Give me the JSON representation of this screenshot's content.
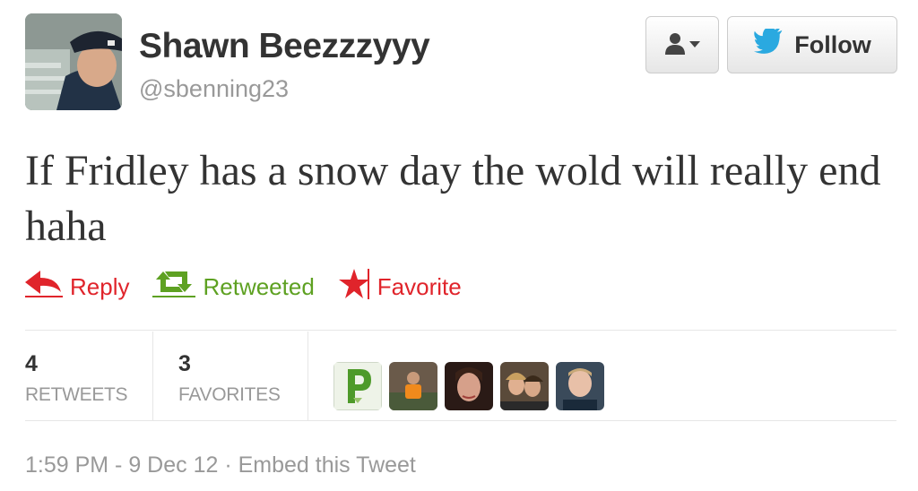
{
  "author": {
    "name": "Shawn Beezzzyyy",
    "handle": "@sbenning23"
  },
  "header_buttons": {
    "follow_label": "Follow"
  },
  "tweet": {
    "text": "If Fridley has a snow day the wold will really end haha"
  },
  "actions": {
    "reply_label": "Reply",
    "retweet_label": "Retweeted",
    "favorite_label": "Favorite"
  },
  "stats": {
    "retweets_count": "4",
    "retweets_label": "RETWEETS",
    "favorites_count": "3",
    "favorites_label": "FAVORITES"
  },
  "footer": {
    "timestamp": "1:59 PM - 9 Dec 12",
    "separator": "·",
    "embed_label": "Embed this Tweet"
  },
  "icons": {
    "user_menu": "person-dropdown-icon",
    "follow": "twitter-bird-icon",
    "reply": "reply-arrow-icon",
    "retweet": "retweet-icon",
    "favorite": "star-icon"
  },
  "colors": {
    "reply": "#e0242b",
    "retweet": "#5ea122",
    "favorite": "#e0242b",
    "twitter_blue": "#2aa9e0",
    "muted": "#999999"
  }
}
